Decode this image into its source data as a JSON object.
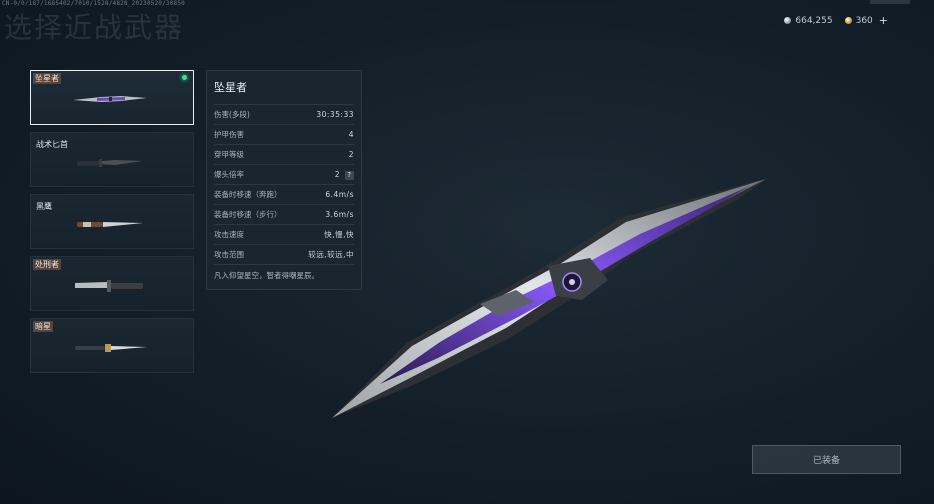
{
  "debug_id": "CN-0/0/187/1685402/7010/1528/4828_20230520/30850",
  "page_title": "选择近战武器",
  "currency": [
    {
      "icon": "silver-coin-icon",
      "amount": "664,255"
    },
    {
      "icon": "gold-coin-icon",
      "amount": "360"
    }
  ],
  "currency_add": "+",
  "weapons": [
    {
      "label": "坠星者",
      "selected": true,
      "equipped": true
    },
    {
      "label": "战术匕首",
      "selected": false
    },
    {
      "label": "黑鹰",
      "selected": false
    },
    {
      "label": "处刑者",
      "selected": false
    },
    {
      "label": "暗星",
      "selected": false
    }
  ],
  "stats": {
    "title": "坠星者",
    "rows": [
      {
        "label": "伤害(多段)",
        "value": "30:35:33"
      },
      {
        "label": "护甲伤害",
        "value": "4"
      },
      {
        "label": "穿甲等级",
        "value": "2"
      },
      {
        "label": "爆头倍率",
        "value": "2",
        "help": "?"
      },
      {
        "label": "装备时移速（奔跑）",
        "value": "6.4m/s"
      },
      {
        "label": "装备时移速（步行）",
        "value": "3.6m/s"
      },
      {
        "label": "攻击速度",
        "value": "快,慢,快"
      },
      {
        "label": "攻击范围",
        "value": "较远,较远,中"
      }
    ],
    "description": "凡入仰望星空，智者得嘲星辰。"
  },
  "equip_button": "已装备",
  "colors": {
    "accent": "#7b4dd6",
    "equipped_dot": "#3ee08e",
    "tag_bg": "#5a4236"
  }
}
